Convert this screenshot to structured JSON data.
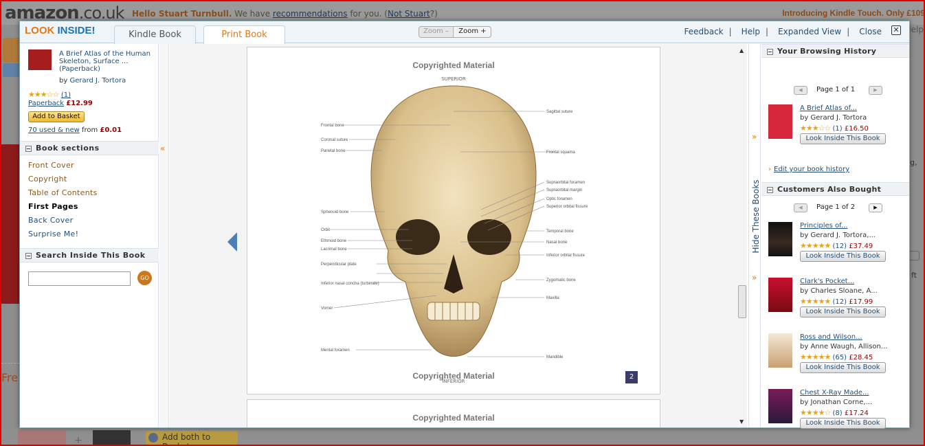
{
  "background": {
    "logo": "amazon",
    "logo_suffix": ".co.uk",
    "greeting_name": "Hello Stuart Turnbull.",
    "greeting_mid": " We have ",
    "greeting_link": "recommendations",
    "greeting_end": " for you. (",
    "not_user": "Not Stuart",
    "greeting_close": "?)",
    "kindle_promo": "Introducing Kindle Touch. Only £109",
    "help": "Help",
    "fre": "Fre",
    "add_both": "Add both to Basket"
  },
  "header": {
    "logo_look": "LOOK ",
    "logo_inside": "INSIDE!",
    "tabs": [
      {
        "label": "Kindle Book"
      },
      {
        "label": "Print Book"
      }
    ],
    "zoom_out": "Zoom –",
    "zoom_in": "Zoom +",
    "links": {
      "feedback": "Feedback",
      "help": "Help",
      "expanded": "Expanded View",
      "close": "Close"
    }
  },
  "book": {
    "title": "A Brief Atlas of the Human Skeleton, Surface ... (Paperback)",
    "by": "by ",
    "author": "Gerard J. Tortora",
    "rating_stars": "★★★☆☆",
    "rating_count": "(1)",
    "format": "Paperback",
    "price": "£12.99",
    "add_to_basket": "Add to Basket",
    "used_new": "70 used & new",
    "used_from": " from ",
    "used_price": "£0.01"
  },
  "sections": {
    "title": "Book sections",
    "items": [
      {
        "label": "Front Cover"
      },
      {
        "label": "Copyright"
      },
      {
        "label": "Table of Contents"
      },
      {
        "label": "First Pages"
      },
      {
        "label": "Back Cover"
      },
      {
        "label": "Surprise Me!"
      }
    ]
  },
  "search": {
    "title": "Search Inside This Book",
    "go": "GO",
    "value": ""
  },
  "viewer": {
    "watermark": "Copyrighted Material",
    "page_number": "2",
    "labels_left": [
      "Frontal bone",
      "Coronal suture",
      "Parietal bone",
      "Sphenoid bone",
      "Orbit",
      "Ethmoid bone",
      "Lacrimal bone",
      "Perpendicular plate",
      "Inferior nasal concha (turbinate)",
      "Vomer",
      "Mental foramen"
    ],
    "labels_right": [
      "Sagittal suture",
      "Frontal squama",
      "Supraorbital foramen",
      "Supraorbital margin",
      "Optic foramen",
      "Superior orbital fissure",
      "Temporal bone",
      "Nasal bone",
      "Inferior orbital fissure",
      "Zygomatic bone",
      "Maxilla",
      "Mandible"
    ],
    "superior": "SUPERIOR",
    "inferior": "INFERIOR"
  },
  "hide_books": "Hide These Books",
  "history": {
    "title": "Your Browsing History",
    "page": "Page 1 of 1",
    "items": [
      {
        "title": "A Brief Atlas of...",
        "author": "by Gerard J. Tortora",
        "stars": "★★★☆☆",
        "count": "(1)",
        "price": "£16.50",
        "button": "Look Inside This Book"
      }
    ],
    "edit": "Edit your book history"
  },
  "also_bought": {
    "title": "Customers Also Bought",
    "page": "Page 1 of 2",
    "items": [
      {
        "title": "Principles of...",
        "author": "by Gerard J. Tortora,...",
        "stars": "★★★★★",
        "count": "(12)",
        "price": "£37.49",
        "button": "Look Inside This Book"
      },
      {
        "title": "Clark's Pocket...",
        "author": "by Charles Sloane, A...",
        "stars": "★★★★★",
        "count": "(12)",
        "price": "£17.99",
        "button": "Look Inside This Book"
      },
      {
        "title": "Ross and Wilson...",
        "author": "by Anne Waugh, Allison...",
        "stars": "★★★★★",
        "count": "(65)",
        "price": "£28.45",
        "button": "Look Inside This Book"
      },
      {
        "title": "Chest X-Ray Made...",
        "author": "by Jonathan Corne,...",
        "stars": "★★★★☆",
        "count": "(8)",
        "price": "£17.24",
        "button": "Look Inside This Book"
      }
    ]
  },
  "colors": {
    "accent": "#e47911",
    "link": "#1f4e79",
    "price": "#990000"
  }
}
